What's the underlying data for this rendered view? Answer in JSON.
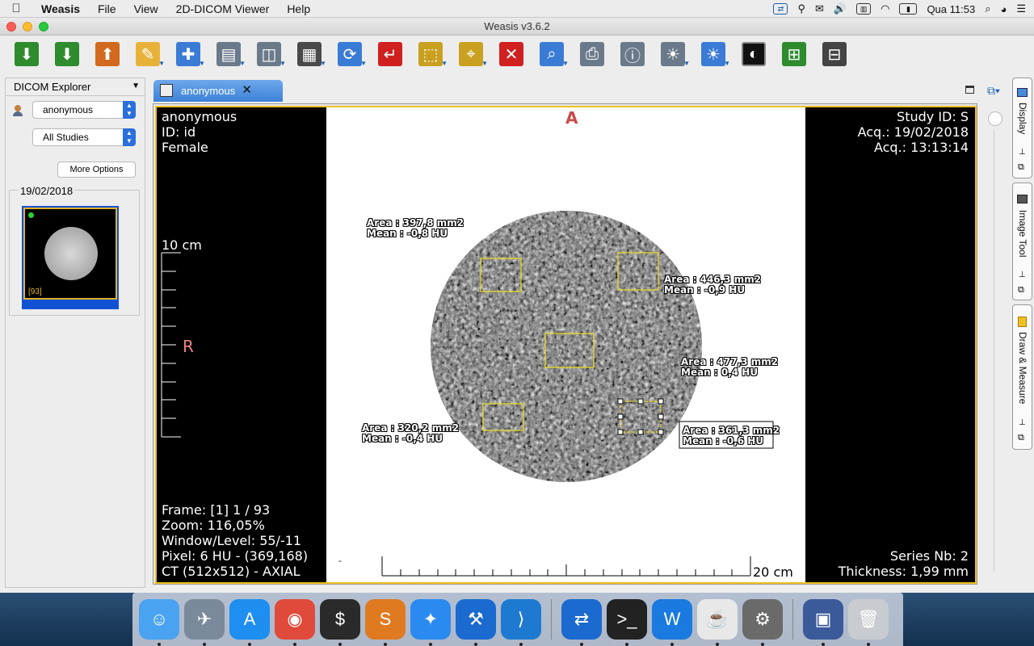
{
  "menubar": {
    "app_name": "Weasis",
    "items": [
      "File",
      "View",
      "2D-DICOM Viewer",
      "Help"
    ],
    "clock": "Qua 11:53"
  },
  "window": {
    "title": "Weasis v3.6.2"
  },
  "toolbar": {
    "buttons": [
      {
        "name": "import-dicom",
        "color": "#2e8b2e",
        "glyph": "⬇"
      },
      {
        "name": "import-dicom-cd",
        "color": "#2e8b2e",
        "glyph": "⬇"
      },
      {
        "name": "export-dicom",
        "color": "#d2691e",
        "glyph": "⬆"
      },
      {
        "name": "window-level",
        "color": "#e8b23a",
        "glyph": "✎"
      },
      {
        "name": "pan-zoom",
        "color": "#3a7bd5",
        "glyph": "✚"
      },
      {
        "name": "synch",
        "color": "#6a7a8a",
        "glyph": "▤"
      },
      {
        "name": "mouse-layout",
        "color": "#6a7a8a",
        "glyph": "◫"
      },
      {
        "name": "layout",
        "color": "#4a4a4a",
        "glyph": "▦"
      },
      {
        "name": "synchronise",
        "color": "#3a7bd5",
        "glyph": "⟳"
      },
      {
        "name": "reset",
        "color": "#d02020",
        "glyph": "↵"
      },
      {
        "name": "selection",
        "color": "#c9a020",
        "glyph": "⬚"
      },
      {
        "name": "crosshair",
        "color": "#c9a020",
        "glyph": "⌖"
      },
      {
        "name": "delete-measure",
        "color": "#d02020",
        "glyph": "✕"
      },
      {
        "name": "zoom",
        "color": "#3a7bd5",
        "glyph": "⌕"
      },
      {
        "name": "print",
        "color": "#6a7a8a",
        "glyph": "⎙"
      },
      {
        "name": "info",
        "color": "#6a7a8a",
        "glyph": "ⓘ"
      },
      {
        "name": "filter",
        "color": "#6a7a8a",
        "glyph": "☀"
      },
      {
        "name": "lut",
        "color": "#3a7bd5",
        "glyph": "☀"
      },
      {
        "name": "invert-lut",
        "color": "#111111",
        "glyph": "◐"
      },
      {
        "name": "mpr",
        "color": "#2e8b2e",
        "glyph": "⊞"
      },
      {
        "name": "3d",
        "color": "#444444",
        "glyph": "⊟"
      }
    ]
  },
  "explorer": {
    "title": "DICOM Explorer",
    "patient_select": "anonymous",
    "studies_select": "All Studies",
    "more_options": "More Options",
    "study_date": "19/02/2018",
    "series_count": "[93]"
  },
  "viewer": {
    "tab_label": "anonymous",
    "orientation_top": "A",
    "orientation_left": "R",
    "top_left": [
      "anonymous",
      "ID: id",
      "Female"
    ],
    "top_right": [
      "Study ID: S",
      "Acq.: 19/02/2018",
      "Acq.: 13:13:14"
    ],
    "bottom_left": [
      "Frame: [1] 1 / 93",
      "Zoom: 116,05%",
      "Window/Level: 55/-11",
      "Pixel: 6 HU - (369,168)",
      "CT (512x512) - AXIAL"
    ],
    "bottom_right": [
      "Series Nb: 2",
      "Thickness: 1,99 mm"
    ],
    "scale_vertical_label": "10 cm",
    "scale_horizontal_label": "20 cm",
    "small_dash": "-",
    "measurements": [
      {
        "area": "Area : 397,8 mm2",
        "mean": "Mean : -0,8 HU"
      },
      {
        "area": "Area : 446,3 mm2",
        "mean": "Mean : -0,9 HU"
      },
      {
        "area": "Area : 477,3 mm2",
        "mean": "Mean : 0,4 HU"
      },
      {
        "area": "Area : 320,2 mm2",
        "mean": "Mean : -0,4 HU"
      },
      {
        "area": "Area : 361,3 mm2",
        "mean": "Mean : -0,6 HU"
      }
    ]
  },
  "side_panels": {
    "display": "Display",
    "image_tool": "Image Tool",
    "draw_measure": "Draw & Measure"
  },
  "dock": {
    "apps": [
      {
        "name": "finder",
        "color": "#4aa3f0",
        "glyph": "☺"
      },
      {
        "name": "launchpad",
        "color": "#7a8a9a",
        "glyph": "✈"
      },
      {
        "name": "app-store",
        "color": "#1e8ef0",
        "glyph": "A"
      },
      {
        "name": "chrome",
        "color": "#e04a3a",
        "glyph": "◉"
      },
      {
        "name": "terminal-green",
        "color": "#2a2a2a",
        "glyph": "$"
      },
      {
        "name": "sublime",
        "color": "#e07a20",
        "glyph": "S"
      },
      {
        "name": "safari",
        "color": "#2a8af0",
        "glyph": "✦"
      },
      {
        "name": "xcode",
        "color": "#1a6ad0",
        "glyph": "⚒"
      },
      {
        "name": "vscode",
        "color": "#1e7ad0",
        "glyph": "⟩"
      },
      {
        "name": "teamviewer",
        "color": "#1a6ad0",
        "glyph": "⇄"
      },
      {
        "name": "terminal",
        "color": "#222222",
        "glyph": ">_"
      },
      {
        "name": "word-w",
        "color": "#1a7ae0",
        "glyph": "W"
      },
      {
        "name": "java",
        "color": "#e8e8e8",
        "glyph": "☕"
      },
      {
        "name": "system-prefs",
        "color": "#6a6a6a",
        "glyph": "⚙"
      },
      {
        "name": "preview",
        "color": "#3a5a9a",
        "glyph": "▣"
      },
      {
        "name": "trash",
        "color": "#c8ccd0",
        "glyph": "🗑"
      }
    ]
  }
}
